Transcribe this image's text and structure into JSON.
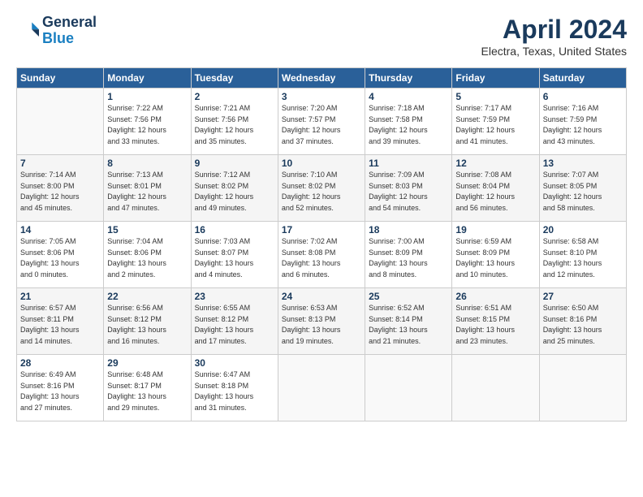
{
  "header": {
    "logo_line1": "General",
    "logo_line2": "Blue",
    "title": "April 2024",
    "subtitle": "Electra, Texas, United States"
  },
  "weekdays": [
    "Sunday",
    "Monday",
    "Tuesday",
    "Wednesday",
    "Thursday",
    "Friday",
    "Saturday"
  ],
  "weeks": [
    [
      {
        "day": "",
        "info": ""
      },
      {
        "day": "1",
        "info": "Sunrise: 7:22 AM\nSunset: 7:56 PM\nDaylight: 12 hours\nand 33 minutes."
      },
      {
        "day": "2",
        "info": "Sunrise: 7:21 AM\nSunset: 7:56 PM\nDaylight: 12 hours\nand 35 minutes."
      },
      {
        "day": "3",
        "info": "Sunrise: 7:20 AM\nSunset: 7:57 PM\nDaylight: 12 hours\nand 37 minutes."
      },
      {
        "day": "4",
        "info": "Sunrise: 7:18 AM\nSunset: 7:58 PM\nDaylight: 12 hours\nand 39 minutes."
      },
      {
        "day": "5",
        "info": "Sunrise: 7:17 AM\nSunset: 7:59 PM\nDaylight: 12 hours\nand 41 minutes."
      },
      {
        "day": "6",
        "info": "Sunrise: 7:16 AM\nSunset: 7:59 PM\nDaylight: 12 hours\nand 43 minutes."
      }
    ],
    [
      {
        "day": "7",
        "info": "Sunrise: 7:14 AM\nSunset: 8:00 PM\nDaylight: 12 hours\nand 45 minutes."
      },
      {
        "day": "8",
        "info": "Sunrise: 7:13 AM\nSunset: 8:01 PM\nDaylight: 12 hours\nand 47 minutes."
      },
      {
        "day": "9",
        "info": "Sunrise: 7:12 AM\nSunset: 8:02 PM\nDaylight: 12 hours\nand 49 minutes."
      },
      {
        "day": "10",
        "info": "Sunrise: 7:10 AM\nSunset: 8:02 PM\nDaylight: 12 hours\nand 52 minutes."
      },
      {
        "day": "11",
        "info": "Sunrise: 7:09 AM\nSunset: 8:03 PM\nDaylight: 12 hours\nand 54 minutes."
      },
      {
        "day": "12",
        "info": "Sunrise: 7:08 AM\nSunset: 8:04 PM\nDaylight: 12 hours\nand 56 minutes."
      },
      {
        "day": "13",
        "info": "Sunrise: 7:07 AM\nSunset: 8:05 PM\nDaylight: 12 hours\nand 58 minutes."
      }
    ],
    [
      {
        "day": "14",
        "info": "Sunrise: 7:05 AM\nSunset: 8:06 PM\nDaylight: 13 hours\nand 0 minutes."
      },
      {
        "day": "15",
        "info": "Sunrise: 7:04 AM\nSunset: 8:06 PM\nDaylight: 13 hours\nand 2 minutes."
      },
      {
        "day": "16",
        "info": "Sunrise: 7:03 AM\nSunset: 8:07 PM\nDaylight: 13 hours\nand 4 minutes."
      },
      {
        "day": "17",
        "info": "Sunrise: 7:02 AM\nSunset: 8:08 PM\nDaylight: 13 hours\nand 6 minutes."
      },
      {
        "day": "18",
        "info": "Sunrise: 7:00 AM\nSunset: 8:09 PM\nDaylight: 13 hours\nand 8 minutes."
      },
      {
        "day": "19",
        "info": "Sunrise: 6:59 AM\nSunset: 8:09 PM\nDaylight: 13 hours\nand 10 minutes."
      },
      {
        "day": "20",
        "info": "Sunrise: 6:58 AM\nSunset: 8:10 PM\nDaylight: 13 hours\nand 12 minutes."
      }
    ],
    [
      {
        "day": "21",
        "info": "Sunrise: 6:57 AM\nSunset: 8:11 PM\nDaylight: 13 hours\nand 14 minutes."
      },
      {
        "day": "22",
        "info": "Sunrise: 6:56 AM\nSunset: 8:12 PM\nDaylight: 13 hours\nand 16 minutes."
      },
      {
        "day": "23",
        "info": "Sunrise: 6:55 AM\nSunset: 8:12 PM\nDaylight: 13 hours\nand 17 minutes."
      },
      {
        "day": "24",
        "info": "Sunrise: 6:53 AM\nSunset: 8:13 PM\nDaylight: 13 hours\nand 19 minutes."
      },
      {
        "day": "25",
        "info": "Sunrise: 6:52 AM\nSunset: 8:14 PM\nDaylight: 13 hours\nand 21 minutes."
      },
      {
        "day": "26",
        "info": "Sunrise: 6:51 AM\nSunset: 8:15 PM\nDaylight: 13 hours\nand 23 minutes."
      },
      {
        "day": "27",
        "info": "Sunrise: 6:50 AM\nSunset: 8:16 PM\nDaylight: 13 hours\nand 25 minutes."
      }
    ],
    [
      {
        "day": "28",
        "info": "Sunrise: 6:49 AM\nSunset: 8:16 PM\nDaylight: 13 hours\nand 27 minutes."
      },
      {
        "day": "29",
        "info": "Sunrise: 6:48 AM\nSunset: 8:17 PM\nDaylight: 13 hours\nand 29 minutes."
      },
      {
        "day": "30",
        "info": "Sunrise: 6:47 AM\nSunset: 8:18 PM\nDaylight: 13 hours\nand 31 minutes."
      },
      {
        "day": "",
        "info": ""
      },
      {
        "day": "",
        "info": ""
      },
      {
        "day": "",
        "info": ""
      },
      {
        "day": "",
        "info": ""
      }
    ]
  ]
}
